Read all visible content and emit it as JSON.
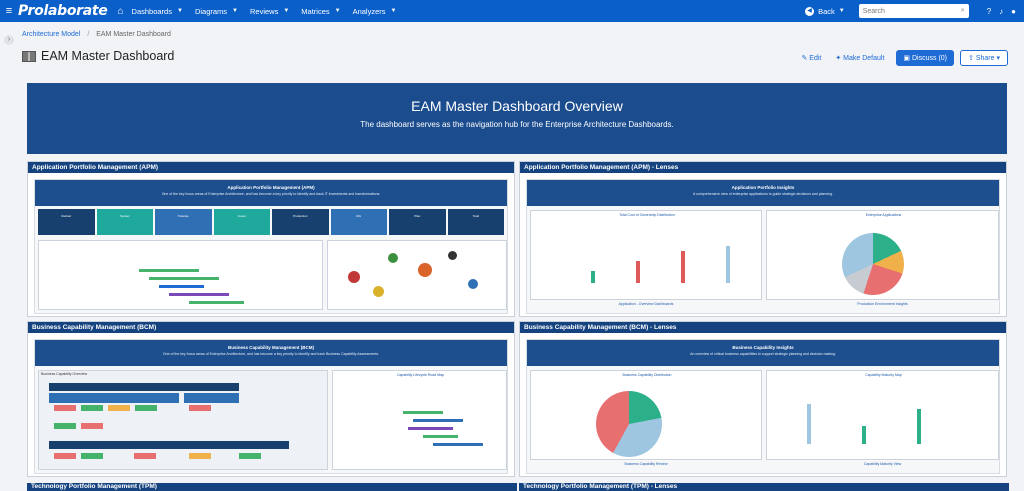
{
  "app": {
    "logo": "Prolaborate",
    "nav": [
      "Dashboards",
      "Diagrams",
      "Reviews",
      "Matrices",
      "Analyzers"
    ],
    "back": "Back",
    "search_placeholder": "Search"
  },
  "breadcrumb": {
    "parent": "Architecture Model",
    "current": "EAM Master Dashboard"
  },
  "page": {
    "title": "EAM Master Dashboard"
  },
  "actions": {
    "edit": "Edit",
    "make_default": "Make Default",
    "discuss": "Discuss (0)",
    "share": "Share"
  },
  "banner": {
    "title": "EAM Master Dashboard Overview",
    "subtitle": "The dashboard serves as the navigation hub for the Enterprise Architecture Dashboards."
  },
  "panels": {
    "apm": {
      "title": "Application Portfolio Management (APM)",
      "band_title": "Application Portfolio Management (APM)",
      "band_sub": "One of the key focus areas of Enterprise Architecture, and has become a key priority to identify and track IT investments and transformations.",
      "kpis": [
        "Retired",
        "Sunset",
        "Tolerate",
        "Invest",
        "Production",
        "Mix",
        "Plan",
        "Total"
      ]
    },
    "apm_lenses": {
      "title": "Application Portfolio Management (APM) - Lenses",
      "band_title": "Application Portfolio Insights",
      "band_sub": "A comprehensive view of enterprise applications to guide strategic decisions and planning.",
      "chart_left": "Total Cost of Ownership Distribution",
      "chart_right": "Enterprise Applications",
      "caption_left": "Application - Overview Dashboards",
      "caption_right": "Production Environment Insights"
    },
    "bcm": {
      "title": "Business Capability Management (BCM)",
      "band_title": "Business Capability Management (BCM)",
      "band_sub": "One of the key focus areas of Enterprise Architecture, and has become a key priority to identify and track Business Capability Assessments.",
      "map_title": "Business Capability Overview",
      "roadmap": "Capability Lifecycle Road Map"
    },
    "bcm_lenses": {
      "title": "Business Capability Management (BCM) - Lenses",
      "band_title": "Business Capability Insights",
      "band_sub": "An overview of critical business capabilities to support strategic planning and decision making.",
      "chart_left": "Business Capability Distribution",
      "chart_right": "Capability Maturity Map",
      "caption_left": "Business Capability Review",
      "caption_right": "Capability Maturity View"
    },
    "tpm": {
      "title": "Technology Portfolio Management (TPM)"
    },
    "tpm_lenses": {
      "title": "Technology Portfolio Management (TPM) - Lenses"
    }
  },
  "colors": {
    "topbar": "#0b5fc9",
    "banner": "#1b4c8e",
    "panel_header": "#154380",
    "accent": "#1e6bd6"
  }
}
